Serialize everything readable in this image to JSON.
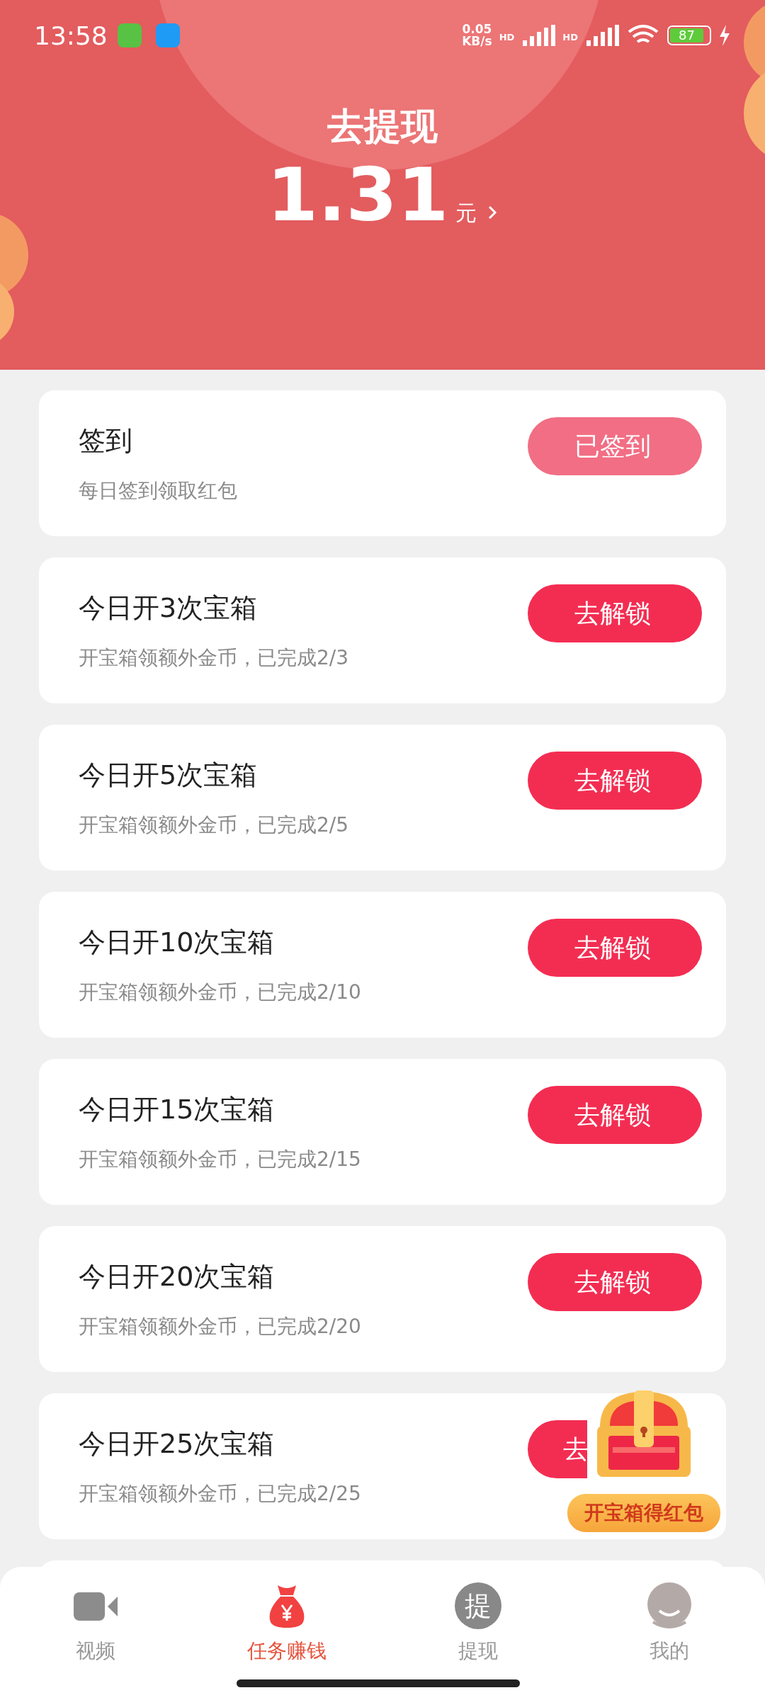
{
  "status_bar": {
    "time": "13:58",
    "net_speed": "0.05",
    "net_unit": "KB/s",
    "signal_labels": [
      "HD",
      "HD"
    ],
    "battery": "87"
  },
  "header": {
    "title": "去提现",
    "amount": "1.31",
    "unit": "元"
  },
  "tasks": [
    {
      "title": "签到",
      "subtitle": "每日签到领取红包",
      "button": "已签到",
      "completed": true
    },
    {
      "title": "今日开3次宝箱",
      "subtitle": "开宝箱领额外金币，已完成2/3",
      "button": "去解锁",
      "completed": false
    },
    {
      "title": "今日开5次宝箱",
      "subtitle": "开宝箱领额外金币，已完成2/5",
      "button": "去解锁",
      "completed": false
    },
    {
      "title": "今日开10次宝箱",
      "subtitle": "开宝箱领额外金币，已完成2/10",
      "button": "去解锁",
      "completed": false
    },
    {
      "title": "今日开15次宝箱",
      "subtitle": "开宝箱领额外金币，已完成2/15",
      "button": "去解锁",
      "completed": false
    },
    {
      "title": "今日开20次宝箱",
      "subtitle": "开宝箱领额外金币，已完成2/20",
      "button": "去解锁",
      "completed": false
    },
    {
      "title": "今日开25次宝箱",
      "subtitle": "开宝箱领额外金币，已完成2/25",
      "button": "去",
      "completed": false
    }
  ],
  "float_badge": {
    "label": "开宝箱得红包"
  },
  "nav": [
    {
      "kind": "video",
      "label": "视频",
      "selected": false
    },
    {
      "kind": "bag",
      "label": "任务赚钱",
      "selected": true
    },
    {
      "kind": "char",
      "label": "提现",
      "icon_char": "提",
      "selected": false
    },
    {
      "kind": "avatar",
      "label": "我的",
      "selected": false
    }
  ]
}
